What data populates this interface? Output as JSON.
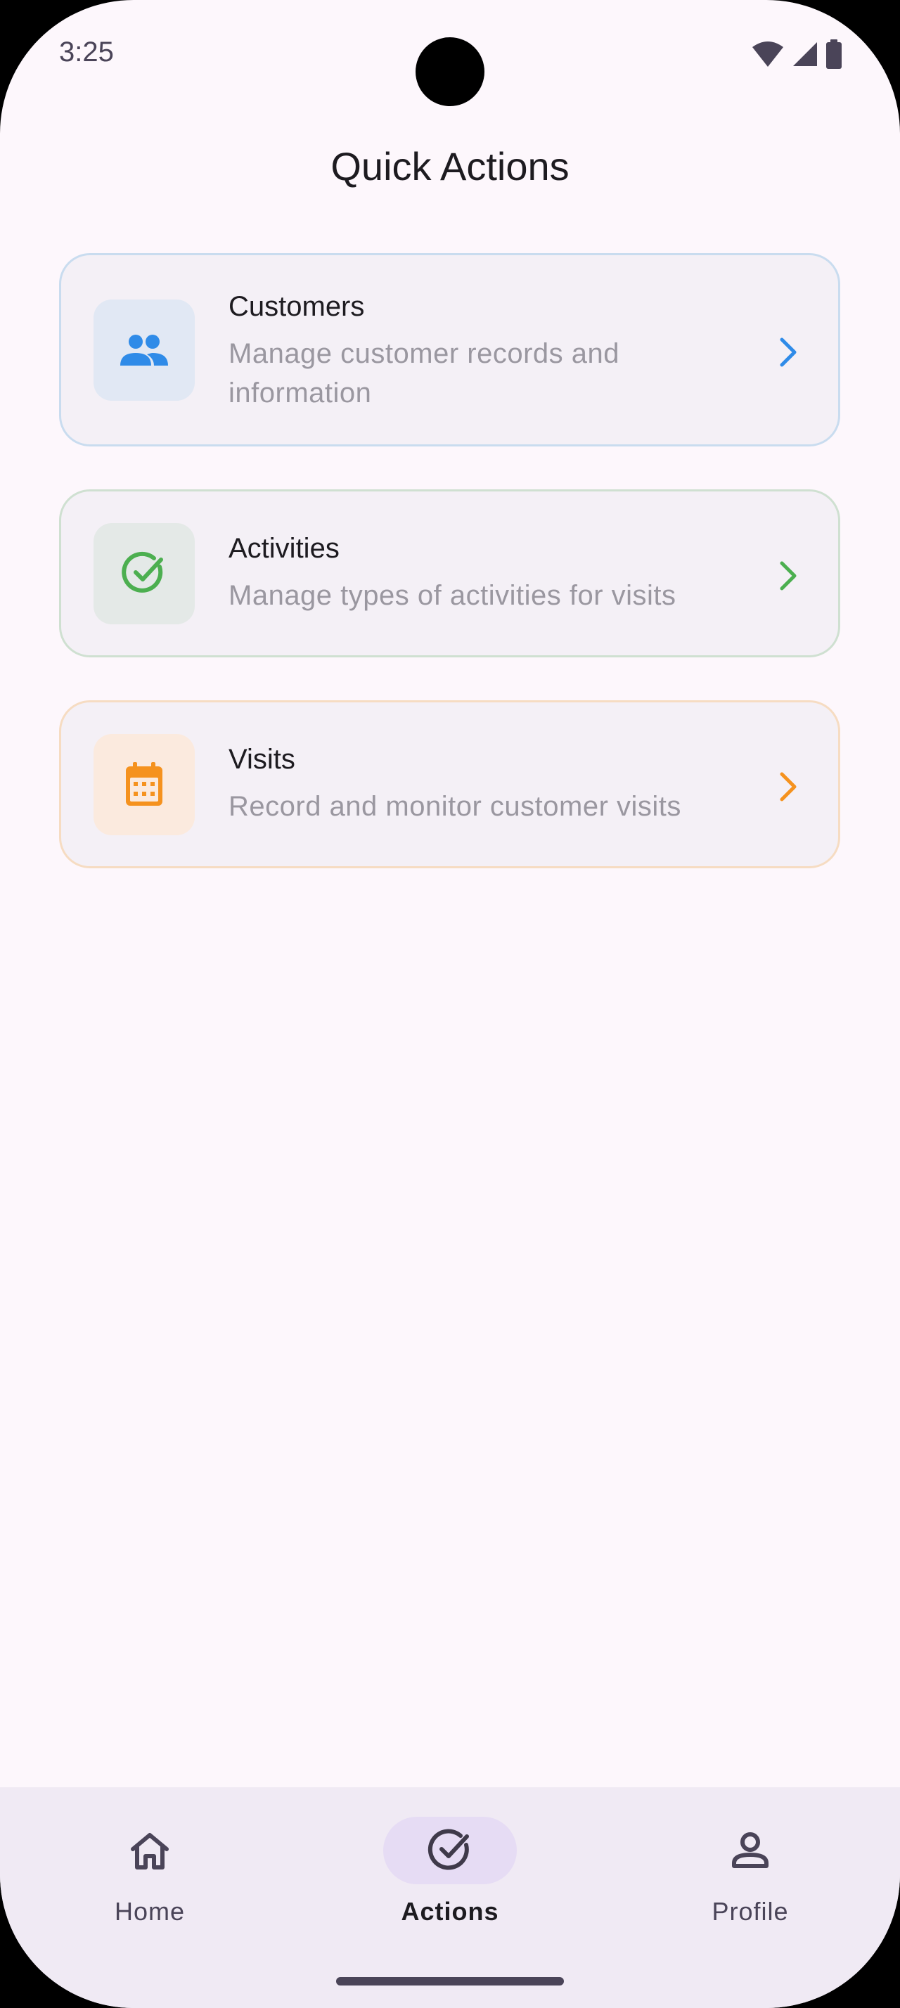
{
  "status_bar": {
    "time": "3:25",
    "icons": [
      "wifi-icon",
      "signal-icon",
      "battery-icon"
    ]
  },
  "page": {
    "title": "Quick Actions"
  },
  "cards": [
    {
      "title": "Customers",
      "description": "Manage customer records and information",
      "icon": "people-icon",
      "accent": "#2f8be8"
    },
    {
      "title": "Activities",
      "description": "Manage types of activities for visits",
      "icon": "check-circle-icon",
      "accent": "#4caf50"
    },
    {
      "title": "Visits",
      "description": "Record and monitor customer visits",
      "icon": "calendar-icon",
      "accent": "#f5921e"
    }
  ],
  "bottom_nav": {
    "items": [
      {
        "label": "Home",
        "icon": "home-icon",
        "selected": false
      },
      {
        "label": "Actions",
        "icon": "check-circle-icon",
        "selected": true
      },
      {
        "label": "Profile",
        "icon": "person-icon",
        "selected": false
      }
    ]
  }
}
